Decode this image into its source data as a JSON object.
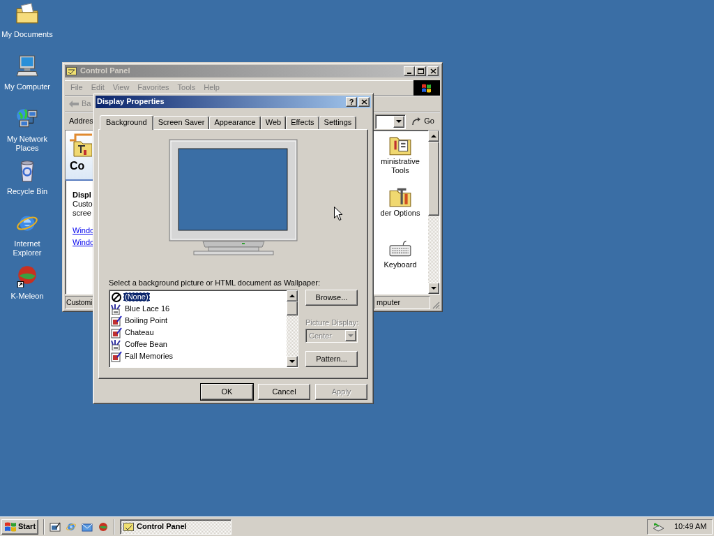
{
  "desktop": {
    "icons": [
      {
        "label": "My Documents",
        "kind": "documents"
      },
      {
        "label": "My Computer",
        "kind": "computer"
      },
      {
        "label": "My Network Places",
        "kind": "network"
      },
      {
        "label": "Recycle Bin",
        "kind": "recycle"
      },
      {
        "label": "Internet Explorer",
        "kind": "browser"
      },
      {
        "label": "K-Meleon",
        "kind": "kmeleon"
      }
    ]
  },
  "control_panel": {
    "title": "Control Panel",
    "active": false,
    "menu": [
      "File",
      "Edit",
      "View",
      "Favorites",
      "Tools",
      "Help"
    ],
    "back_button": "Ba",
    "address_label": "Addres",
    "go_button": "Go",
    "left_pane": {
      "heading": "Co",
      "item_title": "Displ",
      "description": [
        "Custo",
        "scree"
      ],
      "links": [
        "Windo",
        "Windo"
      ]
    },
    "items": [
      {
        "lines": [
          "ministrative",
          "Tools"
        ],
        "kind": "admin"
      },
      {
        "lines": [
          "der Options"
        ],
        "kind": "folder_options"
      },
      {
        "lines": [
          "Keyboard"
        ],
        "kind": "keyboard"
      }
    ],
    "status_left": "Customi",
    "status_right": "mputer"
  },
  "dialog": {
    "title": "Display Properties",
    "active": true,
    "help_button": "?",
    "tabs": [
      {
        "label": "Background",
        "selected": true
      },
      {
        "label": "Screen Saver",
        "selected": false
      },
      {
        "label": "Appearance",
        "selected": false
      },
      {
        "label": "Web",
        "selected": false
      },
      {
        "label": "Effects",
        "selected": false
      },
      {
        "label": "Settings",
        "selected": false
      }
    ],
    "wallpaper_label": "Select a background picture or HTML document as Wallpaper:",
    "wallpapers": [
      {
        "label": "(None)",
        "kind": "none",
        "selected": true
      },
      {
        "label": "Blue Lace 16",
        "kind": "bmp",
        "selected": false
      },
      {
        "label": "Boiling Point",
        "kind": "jpg",
        "selected": false
      },
      {
        "label": "Chateau",
        "kind": "jpg",
        "selected": false
      },
      {
        "label": "Coffee Bean",
        "kind": "bmp",
        "selected": false
      },
      {
        "label": "Fall Memories",
        "kind": "jpg",
        "selected": false
      }
    ],
    "browse_button": "Browse...",
    "picture_display": {
      "label": "Picture Display:",
      "value": "Center",
      "disabled": true
    },
    "pattern_button": "Pattern...",
    "buttons": [
      {
        "label": "OK",
        "default": true,
        "disabled": false
      },
      {
        "label": "Cancel",
        "default": false,
        "disabled": false
      },
      {
        "label": "Apply",
        "default": false,
        "disabled": true
      }
    ]
  },
  "taskbar": {
    "start": "Start",
    "quick_launch": [
      {
        "kind": "desktop"
      },
      {
        "kind": "browser"
      },
      {
        "kind": "outlook"
      },
      {
        "kind": "kmeleon"
      }
    ],
    "tasks": [
      {
        "label": "Control Panel",
        "selected": true
      }
    ],
    "clock": "10:49 AM"
  }
}
